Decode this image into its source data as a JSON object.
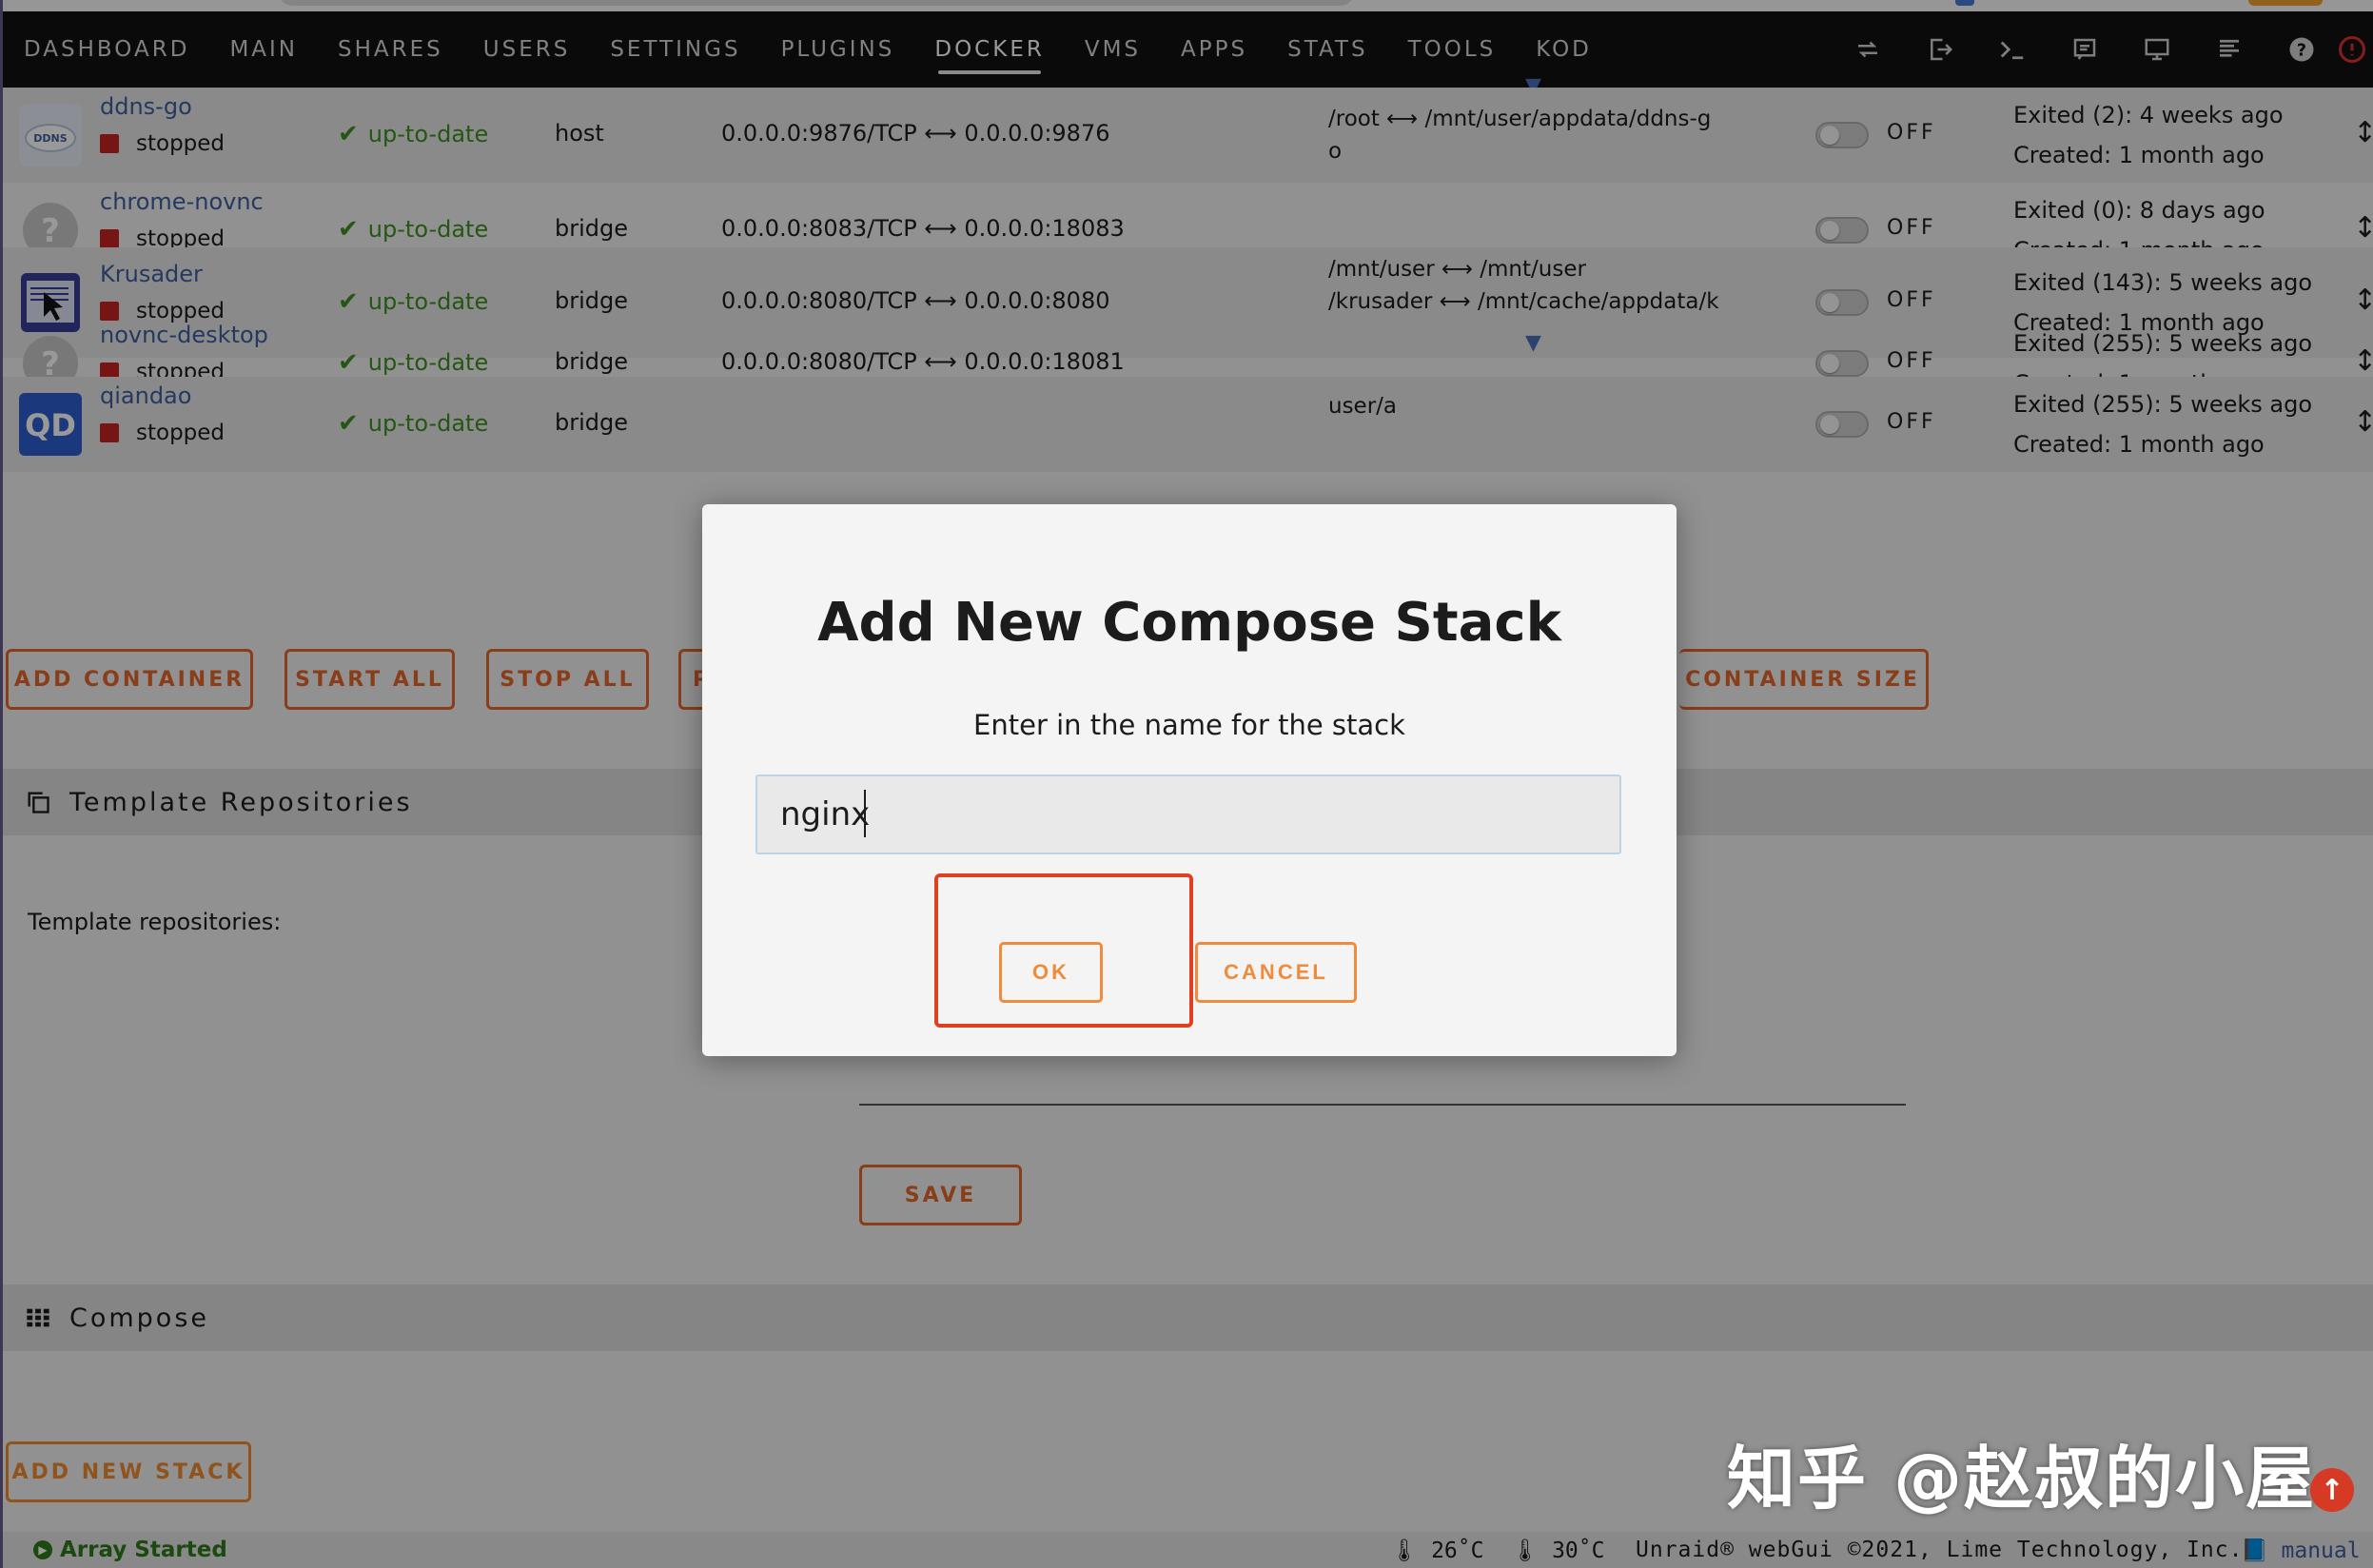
{
  "nav": {
    "items": [
      "DASHBOARD",
      "MAIN",
      "SHARES",
      "USERS",
      "SETTINGS",
      "PLUGINS",
      "DOCKER",
      "VMS",
      "APPS",
      "STATS",
      "TOOLS",
      "KOD"
    ],
    "active": "DOCKER"
  },
  "containers": [
    {
      "name": "ddns-go",
      "state": "stopped",
      "icon_text": "DDNS",
      "update": "up-to-date",
      "network": "host",
      "port": "0.0.0.0:9876/TCP ⟷ 0.0.0.0:9876",
      "volumes": [
        "/root ⟷ /mnt/user/appdata/ddns-g",
        "o"
      ],
      "autostart": "OFF",
      "status1": "Exited (2): 4 weeks ago",
      "status2": "Created: 1 month ago"
    },
    {
      "name": "chrome-novnc",
      "state": "stopped",
      "icon_text": "?",
      "update": "up-to-date",
      "network": "bridge",
      "port": "0.0.0.0:8083/TCP ⟷ 0.0.0.0:18083",
      "volumes": [],
      "autostart": "OFF",
      "status1": "Exited (0): 8 days ago",
      "status2": "Created: 1 month ago"
    },
    {
      "name": "Krusader",
      "state": "stopped",
      "icon_text": "",
      "update": "up-to-date",
      "network": "bridge",
      "port": "0.0.0.0:8080/TCP ⟷ 0.0.0.0:8080",
      "volumes": [
        "/mnt/user ⟷ /mnt/user",
        "/krusader ⟷ /mnt/cache/appdata/k"
      ],
      "autostart": "OFF",
      "status1": "Exited (143): 5 weeks ago",
      "status2": "Created: 1 month ago"
    },
    {
      "name": "novnc-desktop",
      "state": "stopped",
      "icon_text": "?",
      "update": "up-to-date",
      "network": "bridge",
      "port": "0.0.0.0:8080/TCP ⟷ 0.0.0.0:18081",
      "volumes": [],
      "autostart": "OFF",
      "status1": "Exited (255): 5 weeks ago",
      "status2": "Created: 1 month ago"
    },
    {
      "name": "qiandao",
      "state": "stopped",
      "icon_text": "QD",
      "update": "up-to-date",
      "network": "bridge",
      "port": "",
      "volumes": [
        "user/a"
      ],
      "autostart": "OFF",
      "status1": "Exited (255): 5 weeks ago",
      "status2": "Created: 1 month ago"
    }
  ],
  "actions": {
    "add_container": "ADD CONTAINER",
    "start_all": "START ALL",
    "stop_all": "STOP ALL",
    "partial": "P",
    "container_size": "CONTAINER SIZE"
  },
  "templates": {
    "section_title": "Template Repositories",
    "label": "Template repositories:",
    "save": "SAVE"
  },
  "compose": {
    "section_title": "Compose",
    "add_stack": "ADD NEW STACK"
  },
  "footer": {
    "array": "Array Started",
    "temp1": "26˚C",
    "temp2": "30˚C",
    "copyright": "Unraid® webGui ©2021, Lime Technology, Inc.",
    "manual": "manual"
  },
  "modal": {
    "title": "Add New Compose Stack",
    "prompt": "Enter in the name for the stack",
    "input_value": "nginx",
    "ok": "OK",
    "cancel": "CANCEL"
  },
  "watermark": "知乎 @赵叔的小屋",
  "colors": {
    "accent": "#e6662a",
    "link": "#3f5fa0",
    "ok_green": "#3e8f22",
    "stopped_red": "#c62323",
    "highlight": "#e0401f"
  }
}
